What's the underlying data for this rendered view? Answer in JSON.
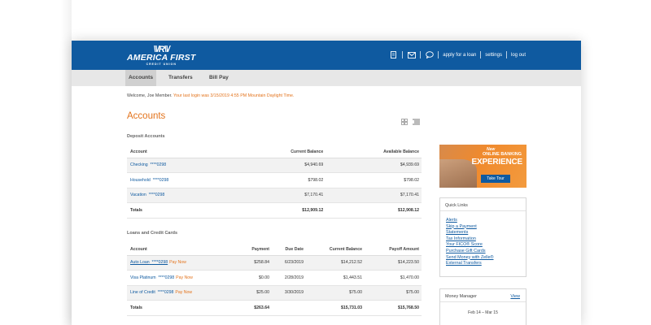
{
  "brand": {
    "mark": "\\\\/R\\\\/",
    "name": "AMERICA FIRST",
    "sub": "CREDIT UNION",
    "primary_color": "#0f5aa0",
    "accent_color": "#e3731c"
  },
  "topnav": {
    "icons": [
      "document-icon",
      "mail-icon",
      "chat-icon"
    ],
    "apply_loan": "apply for a loan",
    "settings": "settings",
    "logout": "log out"
  },
  "tabs": [
    {
      "label": "Accounts",
      "active": true
    },
    {
      "label": "Transfers",
      "active": false
    },
    {
      "label": "Bill Pay",
      "active": false
    }
  ],
  "welcome": {
    "greeting": "Welcome, Joe Member.",
    "last_login": "Your last login was 3/15/2019 4:55 PM Mountain Daylight Time."
  },
  "accounts_title": "Accounts",
  "deposit": {
    "title": "Deposit Accounts",
    "headers": [
      "Account",
      "Current Balance",
      "Available Balance"
    ],
    "rows": [
      {
        "name": "Checking",
        "number": "****0298",
        "current": "$4,940.69",
        "available": "$4,939.69"
      },
      {
        "name": "Household",
        "number": "****0298",
        "current": "$798.02",
        "available": "$798.02"
      },
      {
        "name": "Vacation",
        "number": "****0298",
        "current": "$7,170.41",
        "available": "$7,170.41"
      }
    ],
    "total": {
      "label": "Totals",
      "current": "$12,909.12",
      "available": "$12,908.12"
    }
  },
  "loans": {
    "title": "Loans and Credit Cards",
    "headers": [
      "Account",
      "Payment",
      "Due Date",
      "Current Balance",
      "Payoff Amount"
    ],
    "rows": [
      {
        "name": "Auto Loan",
        "number": "****0298",
        "pay_now": "Pay Now",
        "payment": "$258.84",
        "due": "6/23/2019",
        "current": "$14,212.52",
        "payoff": "$14,223.50"
      },
      {
        "name": "Visa Platinum",
        "number": "****0298",
        "pay_now": "Pay Now",
        "payment": "$0.00",
        "due": "2/28/2019",
        "current": "$1,443.51",
        "payoff": "$1,470.00"
      },
      {
        "name": "Line of Credit",
        "number": "****0298",
        "pay_now": "Pay Now",
        "payment": "$25.00",
        "due": "3/30/2019",
        "current": "$75.00",
        "payoff": "$75.00"
      }
    ],
    "total": {
      "label": "Totals",
      "payment": "$263.64",
      "current": "$15,731.03",
      "payoff": "$15,768.50"
    }
  },
  "promo": {
    "tag": "New",
    "line1": "ONLINE BANKING",
    "line2": "EXPERIENCE",
    "button": "Take Tour"
  },
  "quick_links": {
    "title": "Quick Links",
    "items": [
      "Alerts",
      "Skip a Payment",
      "Statements",
      "Tax Information",
      "Your FICO® Score",
      "Purchase Gift Cards",
      "Send Money with Zelle®",
      "External Transfers"
    ]
  },
  "money_manager": {
    "title": "Money Manager",
    "view": "View",
    "range": "Feb 14 – Mar 15"
  }
}
